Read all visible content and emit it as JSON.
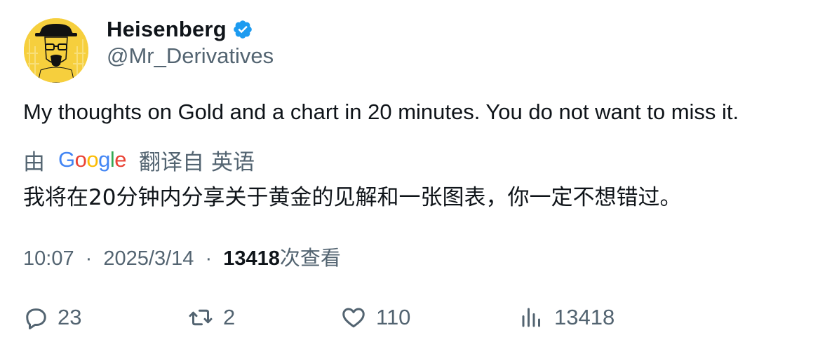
{
  "author": {
    "display_name": "Heisenberg",
    "handle": "@Mr_Derivatives",
    "verified": true,
    "avatar": "heisenberg-avatar"
  },
  "tweet": {
    "text": "My thoughts on Gold and a chart in 20 minutes. You do not want to miss it."
  },
  "translation": {
    "prefix": "由",
    "provider": "Google",
    "from_label": "翻译自",
    "language": "英语",
    "text": "我将在20分钟内分享关于黄金的见解和一张图表，你一定不想错过。"
  },
  "meta": {
    "time": "10:07",
    "separator": "·",
    "date": "2025/3/14",
    "views_count": "13418",
    "views_label": "次查看"
  },
  "actions": {
    "replies": "23",
    "retweets": "2",
    "likes": "110",
    "views": "13418"
  },
  "colors": {
    "text_primary": "#0f1419",
    "text_secondary": "#536471",
    "verified_blue": "#1d9bf0",
    "avatar_bg": "#f6cf3d"
  }
}
